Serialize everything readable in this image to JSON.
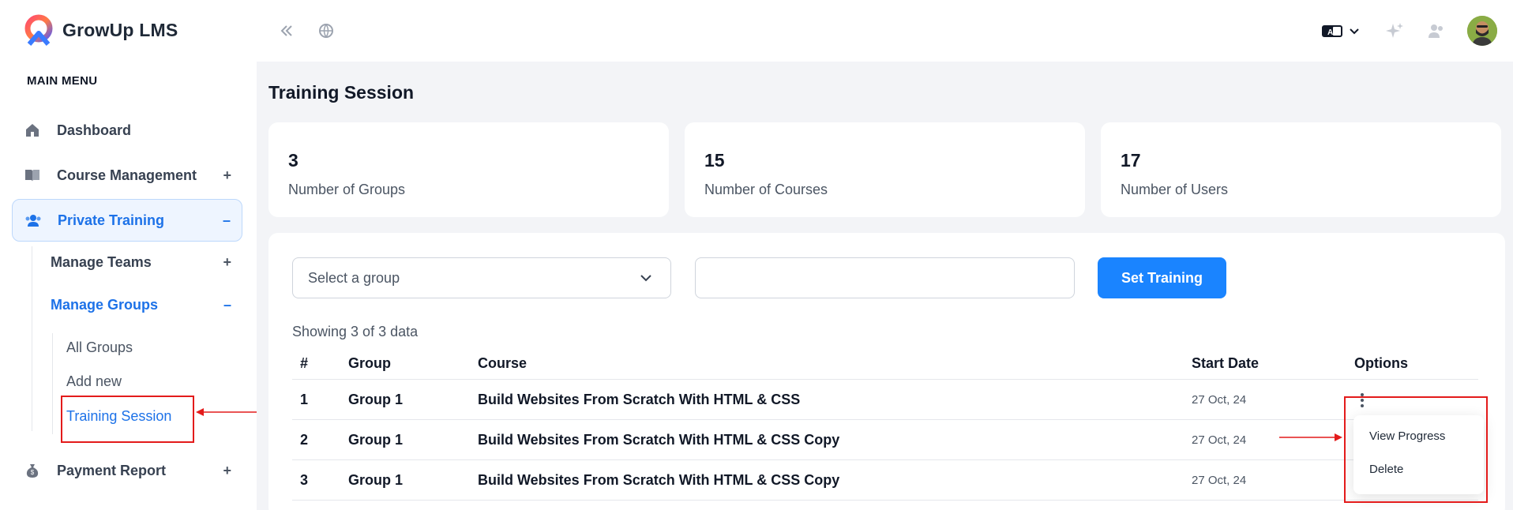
{
  "app": {
    "name": "GrowUp LMS",
    "logo_icon": "growup-logo"
  },
  "sidebar": {
    "menu_title": "MAIN MENU",
    "items": [
      {
        "label": "Dashboard",
        "icon": "home-icon",
        "toggle": ""
      },
      {
        "label": "Course Management",
        "icon": "book-icon",
        "toggle": "+"
      },
      {
        "label": "Private Training",
        "icon": "users-icon",
        "toggle": "–",
        "active": true
      },
      {
        "label": "Payment Report",
        "icon": "money-bag-icon",
        "toggle": "+"
      }
    ],
    "sub_items": [
      {
        "label": "Manage Teams",
        "toggle": "+"
      },
      {
        "label": "Manage Groups",
        "toggle": "–",
        "active": true
      }
    ],
    "leaf_items": [
      {
        "label": "All Groups"
      },
      {
        "label": "Add new"
      },
      {
        "label": "Training Session",
        "active": true
      }
    ]
  },
  "header": {
    "left_icons": [
      "collapse-icon",
      "globe-icon"
    ],
    "right_icons": [
      "translate-icon",
      "chevron-down-icon",
      "sparkle-icon",
      "users-icon",
      "avatar"
    ]
  },
  "page": {
    "title": "Training Session"
  },
  "stats": [
    {
      "value": "3",
      "label": "Number of Groups"
    },
    {
      "value": "15",
      "label": "Number of Courses"
    },
    {
      "value": "17",
      "label": "Number of Users"
    }
  ],
  "filters": {
    "group_select_value": "Select a group",
    "text_input_value": "",
    "set_training_label": "Set Training"
  },
  "table": {
    "showing_text": "Showing 3 of 3 data",
    "columns": [
      "#",
      "Group",
      "Course",
      "Start Date",
      "Options"
    ],
    "rows": [
      {
        "num": "1",
        "group": "Group 1",
        "course": "Build Websites From Scratch With HTML & CSS",
        "start_date": "27 Oct, 24"
      },
      {
        "num": "2",
        "group": "Group 1",
        "course": "Build Websites From Scratch With HTML & CSS Copy",
        "start_date": "27 Oct, 24"
      },
      {
        "num": "3",
        "group": "Group 1",
        "course": "Build Websites From Scratch With HTML & CSS Copy",
        "start_date": "27 Oct, 24"
      }
    ]
  },
  "options_menu": {
    "items": [
      "View Progress",
      "Delete"
    ]
  },
  "colors": {
    "accent": "#1a84ff",
    "annotation": "#e31b1b"
  }
}
